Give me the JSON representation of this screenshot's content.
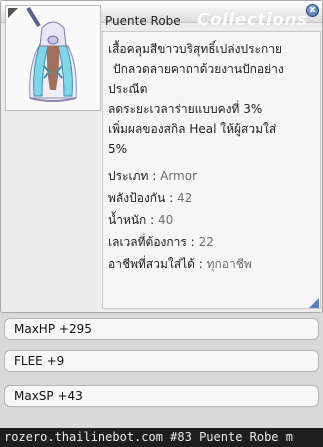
{
  "window": {
    "title": "Puente Robe",
    "watermark": "Collections",
    "close_icon": "close-icon",
    "item_image_icon": "robe-item-icon"
  },
  "description": {
    "lines": [
      "เสื้อคลุมสีขาวบริสุทธิ์เปล่งประกาย",
      "ปักลวดลายคาถาด้วยงานปักอย่าง",
      "ประณีต",
      "ลดระยะเวลาร่ายแบบคงที่ 3%",
      "เพิ่มผลของสกิล Heal ให้ผู้สวมใส่",
      "5%"
    ],
    "stats": [
      {
        "label": "ประเภท :",
        "value": "Armor"
      },
      {
        "label": "พลังป้องกัน :",
        "value": "42"
      },
      {
        "label": "น้ำหนัก :",
        "value": "40"
      },
      {
        "label": "เลเวลที่ต้องการ :",
        "value": "22"
      },
      {
        "label": "อาชีพที่สวมใส่ได้ :",
        "value": "ทุกอาชีพ"
      }
    ]
  },
  "options": [
    "MaxHP +295",
    "FLEE +9",
    "MaxSP +43"
  ],
  "footer": "rozero.thailinebot.com  #83  Puente Robe  m"
}
